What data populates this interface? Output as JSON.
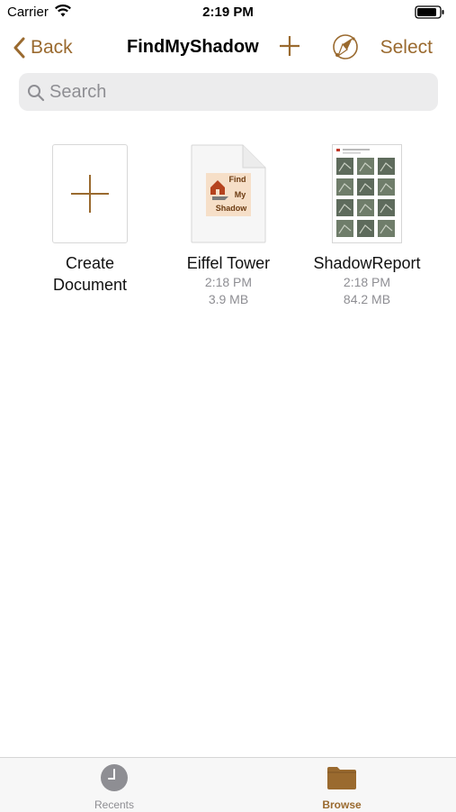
{
  "status_bar": {
    "carrier": "Carrier",
    "time": "2:19 PM"
  },
  "nav": {
    "back_label": "Back",
    "title": "FindMyShadow",
    "select_label": "Select"
  },
  "search": {
    "placeholder": "Search"
  },
  "items": [
    {
      "title_line1": "Create",
      "title_line2": "Document"
    },
    {
      "title": "Eiffel Tower",
      "time": "2:18 PM",
      "size": "3.9 MB",
      "thumb_text": [
        "Find",
        "My",
        "Shadow"
      ]
    },
    {
      "title": "ShadowReport",
      "time": "2:18 PM",
      "size": "84.2 MB"
    }
  ],
  "tabbar": {
    "tabs": [
      {
        "label": "Recents",
        "active": false
      },
      {
        "label": "Browse",
        "active": true
      }
    ]
  },
  "colors": {
    "accent": "#9a6a2f",
    "inactive": "#8e8e93"
  }
}
